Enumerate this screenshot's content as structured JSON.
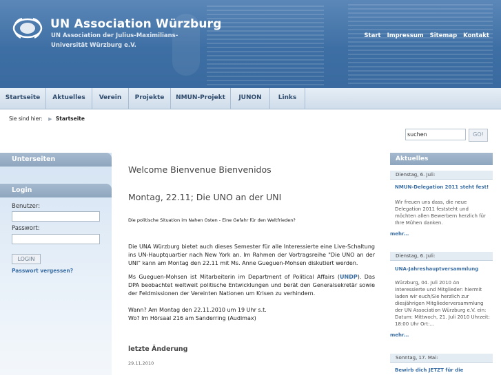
{
  "header": {
    "title": "UN Association Würzburg",
    "subtitle": "UN Association der Julius-Maximilians-Universität Würzburg e.V.",
    "top_links": [
      "Start",
      "Impressum",
      "Sitemap",
      "Kontakt"
    ]
  },
  "nav": {
    "items": [
      "Startseite",
      "Aktuelles",
      "Verein",
      "Projekte",
      "NMUN-Projekt",
      "JUNON",
      "Links"
    ]
  },
  "breadcrumb": {
    "prefix": "Sie sind hier:",
    "current": "Startseite"
  },
  "search": {
    "value": "suchen",
    "button_label": "GO!"
  },
  "left": {
    "subpages_title": "Unterseiten",
    "login_title": "Login",
    "user_label": "Benutzer:",
    "password_label": "Passwort:",
    "login_button": "LOGIN",
    "forgot_link": "Passwort vergessen?"
  },
  "main": {
    "welcome": "Welcome Bienvenue Bienvenidos",
    "article_title": "Montag, 22.11; Die UNO an der UNI",
    "lead": "Die politische Situation im Nahen Osten - Eine Gefahr für den Weltfrieden?",
    "para1": "Die UNA Würzburg bietet auch dieses Semester für alle Interessierte eine Live-Schaltung ins UN-Hauptquartier nach New York an. Im Rahmen der Vortragsreihe \"Die UNO an der UNI\" kann am Montag den 22.11 mit Ms. Anne Gueguen-Mohsen diskutiert werden.",
    "para2_a": "Ms Gueguen-Mohsen ist Mitarbeiterin im Department of Political Affairs (",
    "para2_undp": "UNDP",
    "para2_b": "). Das DPA beobachtet weltweit politische Entwicklungen und berät den Generalsekretär sowie der Feldmissionen der Vereinten Nationen um Krisen zu verhindern.",
    "when": "Wann? Am Montag den 22.11.2010 um 19 Uhr s.t.",
    "where": "Wo? Im Hörsaal 216 am Sanderring (Audimax)",
    "last_change_label": "letzte Änderung",
    "last_change_date": "29.11.2010"
  },
  "news": {
    "title": "Aktuelles",
    "items": [
      {
        "date": "Dienstag, 6. Juli:",
        "title": "NMUN-Delegation 2011 steht fest!",
        "body": "Wir freuen uns dass, die neue Delegation 2011 feststeht und möchten allen Bewerbern herzlich für Ihre Mühen danken.",
        "more": "mehr..."
      },
      {
        "date": "Dienstag, 6. Juli:",
        "title": "UNA-Jahreshauptversammlung",
        "body": "Würzburg, 04. Juli 2010 An Interessierte und Mitglieder: hiermit laden wir euch/Sie herzlich zur diesjährigen Mitgliederversammlung der UN Association Würzburg e.V. ein: Datum: Mittwoch, 21. Juli 2010 Uhrzeit: 18:00 Uhr Ort:...",
        "more": "mehr..."
      },
      {
        "date": "Sonntag, 17. Mai:",
        "title": "Bewirb dich JETZT für die"
      }
    ]
  },
  "colors": {
    "header_blue": "#3e6fa4",
    "link_blue": "#3a6ea5",
    "panel_grey_blue": "#8ea6bf"
  }
}
